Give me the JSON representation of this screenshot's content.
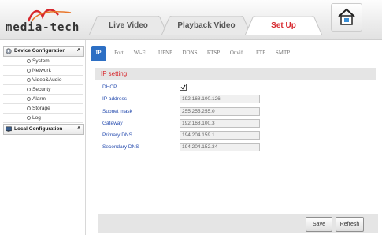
{
  "brand": {
    "logo_text": "media-tech"
  },
  "nav": {
    "tabs": [
      {
        "label": "Live Video"
      },
      {
        "label": "Playback Video"
      },
      {
        "label": "Set Up"
      }
    ],
    "active_tab": "Set Up"
  },
  "sidebar": {
    "device_config": {
      "label": "Device Configuration",
      "items": [
        {
          "label": "System"
        },
        {
          "label": "Network"
        },
        {
          "label": "Video&Audio"
        },
        {
          "label": "Security"
        },
        {
          "label": "Alarm"
        },
        {
          "label": "Storage"
        },
        {
          "label": "Log"
        }
      ]
    },
    "local_config": {
      "label": "Local Configuration"
    }
  },
  "subtabs": [
    "IP",
    "Port",
    "Wi-Fi",
    "UPNP",
    "DDNS",
    "RTSP",
    "Onvif",
    "FTP",
    "SMTP"
  ],
  "active_subtab": "IP",
  "ip_setting": {
    "title": "IP setting",
    "dhcp": {
      "label": "DHCP",
      "checked": true
    },
    "fields": [
      {
        "label": "IP address",
        "value": "192.168.100.126"
      },
      {
        "label": "Subnet mask",
        "value": "255.255.255.0"
      },
      {
        "label": "Gateway",
        "value": "192.168.100.3"
      },
      {
        "label": "Primary DNS",
        "value": "194.204.159.1"
      },
      {
        "label": "Secondary DNS",
        "value": "194.204.152.34"
      }
    ]
  },
  "buttons": {
    "save": "Save",
    "refresh": "Refresh"
  },
  "colors": {
    "accent_red": "#d7272d",
    "active_blue": "#2d6fc4",
    "label_blue": "#2a4fb0"
  }
}
